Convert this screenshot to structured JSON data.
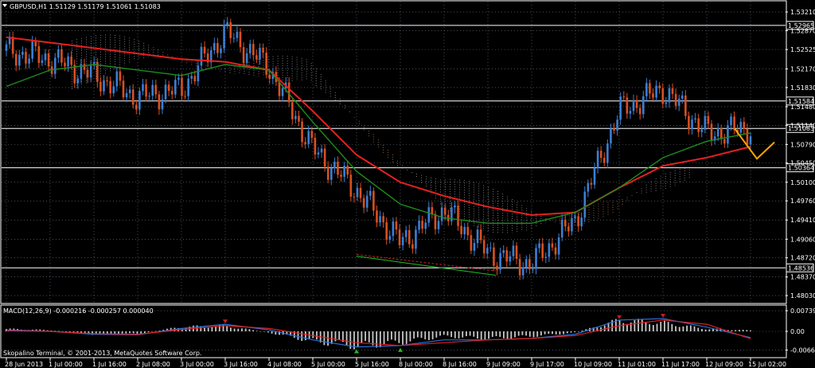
{
  "colors": {
    "background": "#000000",
    "foreground": "#ffffff",
    "grid": "#6f7f8f",
    "bull": "#3a7fd4",
    "bear": "#d9501f",
    "ma_slow": "#e62020",
    "ma_mid": "#1e8c1e",
    "cloud": "#c9c9c9",
    "cloud_alt": "#f0a070",
    "projection": "#ffa500",
    "macd_main": "#2a6fd8",
    "macd_signal": "#e02020",
    "macd_hist": "#c8c8c8",
    "trend_up": "#20c020",
    "trend_down": "#c02020"
  },
  "main": {
    "symbol_label": "GBPUSD,H1  1.51129 1.51179 1.51061 1.51083",
    "ylim": [
      1.479,
      1.534
    ],
    "price_ticks": [
      "1.53210",
      "1.52870",
      "1.52525",
      "1.52170",
      "1.51830",
      "1.51480",
      "1.51140",
      "1.50790",
      "1.50450",
      "1.50100",
      "1.49760",
      "1.49410",
      "1.49060",
      "1.48720",
      "1.48370",
      "1.48030"
    ],
    "price_tick_values": [
      1.5321,
      1.5287,
      1.52525,
      1.5217,
      1.5183,
      1.5148,
      1.5114,
      1.5079,
      1.5045,
      1.501,
      1.4976,
      1.4941,
      1.4906,
      1.4872,
      1.4837,
      1.4803
    ],
    "levels": [
      {
        "label": "1.52965",
        "value": 1.52965
      },
      {
        "label": "1.51584",
        "value": 1.51584
      },
      {
        "label": "1.51083",
        "value": 1.51083
      },
      {
        "label": "1.50364",
        "value": 1.50364
      },
      {
        "label": "1.48536",
        "value": 1.48536
      }
    ]
  },
  "macd": {
    "label": "MACD(12,26,9) -0.000216 -0.000257 0.000040",
    "ylim": [
      -0.0009,
      0.0009
    ],
    "ticks": [
      "0.00739",
      "0.00",
      "-0.00663"
    ],
    "tick_values": [
      0.00073,
      0.0,
      -0.00066
    ]
  },
  "time_axis": [
    "28 Jun 2013",
    "1 Jul 00:00",
    "1 Jul 16:00",
    "2 Jul 08:00",
    "3 Jul 00:00",
    "3 Jul 16:00",
    "4 Jul 08:00",
    "5 Jul 00:00",
    "5 Jul 16:00",
    "8 Jul 00:00",
    "8 Jul 16:00",
    "9 Jul 09:00",
    "9 Jul 17:00",
    "10 Jul 09:00",
    "11 Jul 01:00",
    "11 Jul 17:00",
    "12 Jul 09:00",
    "15 Jul 02:00"
  ],
  "copyright": "Skopalino Terminal, © 2001-2013, MetaQuotes Software Corp.",
  "chart_data": [
    {
      "type": "line",
      "title": "GBPUSD,H1",
      "ylabel": "",
      "xlabel": "",
      "x": [
        "28 Jun 2013",
        "1 Jul 00:00",
        "1 Jul 16:00",
        "2 Jul 08:00",
        "3 Jul 00:00",
        "3 Jul 16:00",
        "4 Jul 08:00",
        "5 Jul 00:00",
        "5 Jul 16:00",
        "8 Jul 00:00",
        "8 Jul 16:00",
        "9 Jul 09:00",
        "9 Jul 17:00",
        "10 Jul 09:00",
        "11 Jul 01:00",
        "11 Jul 17:00",
        "12 Jul 09:00",
        "15 Jul 02:00"
      ],
      "series": [
        {
          "values": [
            1.525,
            1.5235,
            1.5205,
            1.5165,
            1.518,
            1.5285,
            1.522,
            1.507,
            1.4995,
            1.49,
            1.496,
            1.488,
            1.486,
            1.494,
            1.514,
            1.518,
            1.51,
            1.5108
          ]
        },
        {
          "values": [
            1.5275,
            1.5265,
            1.5255,
            1.5245,
            1.5235,
            1.523,
            1.5215,
            1.514,
            1.506,
            1.501,
            1.4985,
            1.4965,
            1.495,
            1.4955,
            1.5,
            1.504,
            1.5055,
            1.5075
          ]
        },
        {
          "values": [
            1.5185,
            1.5215,
            1.5225,
            1.5215,
            1.5205,
            1.5225,
            1.5215,
            1.512,
            1.503,
            1.497,
            1.4945,
            1.4935,
            1.4935,
            1.4955,
            1.5,
            1.5055,
            1.5085,
            1.51
          ]
        }
      ],
      "ylim": [
        1.479,
        1.534
      ],
      "grid": true
    },
    {
      "type": "bar",
      "title": "MACD(12,26,9)",
      "categories": [
        "28 Jun 2013",
        "1 Jul 00:00",
        "1 Jul 16:00",
        "2 Jul 08:00",
        "3 Jul 00:00",
        "3 Jul 16:00",
        "4 Jul 08:00",
        "5 Jul 00:00",
        "5 Jul 16:00",
        "8 Jul 00:00",
        "8 Jul 16:00",
        "9 Jul 09:00",
        "9 Jul 17:00",
        "10 Jul 09:00",
        "11 Jul 01:00",
        "11 Jul 17:00",
        "12 Jul 09:00",
        "15 Jul 02:00"
      ],
      "values": [
        0.0001,
        5e-05,
        -0.00012,
        -0.0001,
        0.00018,
        0.00022,
        -5e-05,
        -0.0004,
        -0.0006,
        -0.00045,
        -0.0002,
        -0.0003,
        -0.0002,
        -5e-05,
        0.00045,
        0.00035,
        0.0001,
        4e-05
      ],
      "series": [
        {
          "values": [
            5e-05,
            0.0,
            -0.0001,
            -0.00012,
            0.0001,
            0.00025,
            5e-05,
            -0.0003,
            -0.00055,
            -0.0005,
            -0.0003,
            -0.0003,
            -0.00025,
            -0.0001,
            0.0004,
            0.00045,
            0.00015,
            -0.00022
          ]
        },
        {
          "values": [
            2e-05,
            0.0,
            -8e-05,
            -0.0001,
            6e-05,
            0.0002,
            0.0001,
            -0.00015,
            -0.0004,
            -0.0005,
            -0.0004,
            -0.0003,
            -0.00025,
            -0.00015,
            0.0002,
            0.0004,
            0.00025,
            -0.00026
          ]
        }
      ],
      "ylim": [
        -0.0009,
        0.0009
      ],
      "grid": true
    }
  ]
}
